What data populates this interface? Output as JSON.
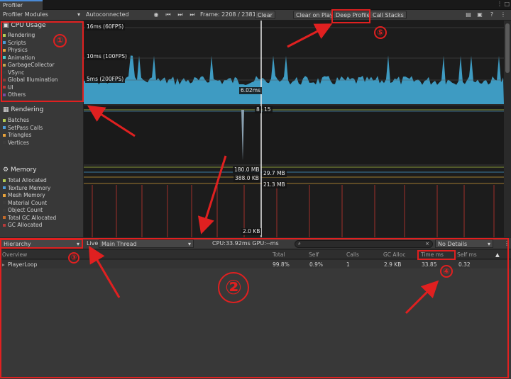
{
  "window": {
    "tab_title": "Profiler"
  },
  "toolbar": {
    "modules_dropdown": "Profiler Modules",
    "target_dropdown": "Autoconnected Player",
    "frame_label": "Frame: 2208 / 2381",
    "clear": "Clear",
    "clear_on_play": "Clear on Play",
    "deep_profile": "Deep Profile",
    "call_stacks": "Call Stacks"
  },
  "modules": {
    "cpu": {
      "title": "CPU Usage",
      "items": [
        {
          "label": "Rendering",
          "color": "#b5cc52"
        },
        {
          "label": "Scripts",
          "color": "#4d9bd6"
        },
        {
          "label": "Physics",
          "color": "#e7a23a"
        },
        {
          "label": "Animation",
          "color": "#4ac8c8"
        },
        {
          "label": "GarbageCollector",
          "color": "#c4a54a"
        },
        {
          "label": "VSync",
          "color": "#3c3c3c"
        },
        {
          "label": "Global Illumination",
          "color": "#8a3a3a"
        },
        {
          "label": "UI",
          "color": "#b83a3a"
        },
        {
          "label": "Others",
          "color": "#7a4aa0"
        }
      ]
    },
    "rendering": {
      "title": "Rendering",
      "items": [
        {
          "label": "Batches",
          "color": "#b5cc52"
        },
        {
          "label": "SetPass Calls",
          "color": "#4d9bd6"
        },
        {
          "label": "Triangles",
          "color": "#e7a23a"
        },
        {
          "label": "Vertices",
          "color": "#3c3c3c"
        }
      ]
    },
    "memory": {
      "title": "Memory",
      "items": [
        {
          "label": "Total Allocated",
          "color": "#b5cc52"
        },
        {
          "label": "Texture Memory",
          "color": "#4d9bd6"
        },
        {
          "label": "Mesh Memory",
          "color": "#e7a23a"
        },
        {
          "label": "Material Count",
          "color": "#3c3c3c"
        },
        {
          "label": "Object Count",
          "color": "#3c3c3c"
        },
        {
          "label": "Total GC Allocated",
          "color": "#c46a2a"
        },
        {
          "label": "GC Allocated",
          "color": "#b83a3a"
        }
      ]
    }
  },
  "cpu_chart": {
    "line_16": "16ms (60FPS)",
    "line_10": "10ms (100FPS)",
    "line_5": "5ms (200FPS)",
    "selected": "6.02ms"
  },
  "render_chart": {
    "val_a": "8",
    "val_b": "15"
  },
  "memory_chart": {
    "v1": "180.0 MB",
    "v2": "29.7 MB",
    "v3": "388.0 KB",
    "v4": "21.3 MB",
    "v5": "2.0 KB"
  },
  "details": {
    "view_dropdown": "Hierarchy",
    "live": "Live",
    "thread_dropdown": "Main Thread",
    "cpu_gpu": "CPU:33.92ms  GPU:--ms",
    "details_dropdown": "No Details"
  },
  "table": {
    "headers": {
      "overview": "Overview",
      "total": "Total",
      "self": "Self",
      "calls": "Calls",
      "gc": "GC Alloc",
      "time": "Time ms",
      "selfms": "Self ms"
    },
    "row": {
      "name": "PlayerLoop",
      "total": "99.8%",
      "self": "0.9%",
      "calls": "1",
      "gc": "2.9 KB",
      "time": "33.85",
      "selfms": "0.32"
    }
  },
  "annotations": {
    "n1": "①",
    "n2": "②",
    "n3": "③",
    "n4": "④",
    "n5": "⑤"
  }
}
